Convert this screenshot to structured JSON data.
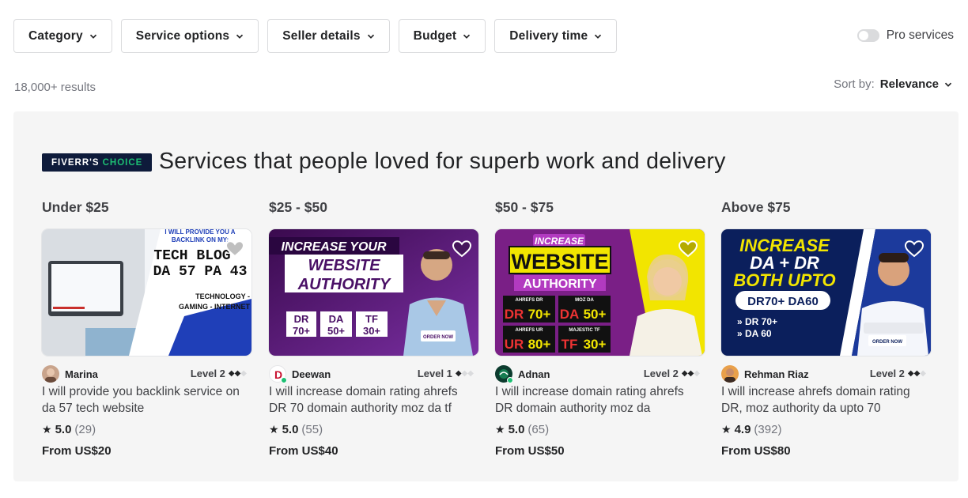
{
  "filters": [
    {
      "label": "Category"
    },
    {
      "label": "Service options"
    },
    {
      "label": "Seller details"
    },
    {
      "label": "Budget"
    },
    {
      "label": "Delivery time"
    }
  ],
  "pro_toggle": {
    "label": "Pro services",
    "enabled": false
  },
  "results_count": "18,000+ results",
  "sort": {
    "label": "Sort by:",
    "value": "Relevance"
  },
  "choice_panel": {
    "badge_white": "FIVERR'S",
    "badge_green": "CHOICE",
    "title": "Services that people loved for superb work and delivery",
    "columns": [
      {
        "range": "Under $25",
        "seller": "Marina",
        "level": "Level 2",
        "level_diamonds": 2,
        "online": false,
        "title": "I will provide you backlink service on da 57 tech website",
        "rating": "5.0",
        "reviews": "(29)",
        "price": "From US$20",
        "thumb_text": {
          "header1": "I WILL PROVIDE YOU A",
          "header2": "BACKLINK ON MY:",
          "line1": "TECH BLOG",
          "line2": "DA 57 PA 43",
          "tag1": "TECHNOLOGY -",
          "tag2": "GAMING - INTERNET"
        }
      },
      {
        "range": "$25 - $50",
        "seller": "Deewan",
        "level": "Level 1",
        "level_diamonds": 1,
        "online": true,
        "title": "I will increase domain rating ahrefs DR 70 domain authority moz da tf with...",
        "rating": "5.0",
        "reviews": "(55)",
        "price": "From US$40",
        "thumb_text": {
          "line1": "INCREASE YOUR",
          "line2": "WEBSITE",
          "line3": "AUTHORITY",
          "m1a": "DR",
          "m1b": "70+",
          "m2a": "DA",
          "m2b": "50+",
          "m3a": "TF",
          "m3b": "30+",
          "cta": "ORDER NOW"
        }
      },
      {
        "range": "$50 - $75",
        "seller": "Adnan",
        "level": "Level 2",
        "level_diamonds": 2,
        "online": true,
        "title": "I will increase domain rating ahrefs DR domain authority moz da majestic...",
        "rating": "5.0",
        "reviews": "(65)",
        "price": "From US$50",
        "thumb_text": {
          "line1": "INCREASE",
          "line2": "WEBSITE",
          "line3": "AUTHORITY",
          "c1l": "AHREFS DR",
          "c1": "DR",
          "c1v": "70+",
          "c2l": "MOZ DA",
          "c2": "DA",
          "c2v": "50+",
          "c3l": "AHREFS UR",
          "c3": "UR",
          "c3v": "80+",
          "c4l": "MAJESTIC TF",
          "c4": "TF",
          "c4v": "30+"
        }
      },
      {
        "range": "Above $75",
        "seller": "Rehman Riaz",
        "level": "Level 2",
        "level_diamonds": 2,
        "online": false,
        "title": "I will increase ahrefs domain rating DR, moz authority da upto 70",
        "rating": "4.9",
        "reviews": "(392)",
        "price": "From US$80",
        "thumb_text": {
          "line1": "INCREASE",
          "line2": "DA + DR",
          "line3": "BOTH UPTO",
          "line4": "DR70+ DA60",
          "b1": "» DR 70+",
          "b2": "» DA 60",
          "cta": "ORDER NOW"
        }
      }
    ]
  },
  "colors": {
    "brand_green": "#1dbf73",
    "badge_navy": "#0e1b3b",
    "panel_bg": "#f5f5f5"
  }
}
